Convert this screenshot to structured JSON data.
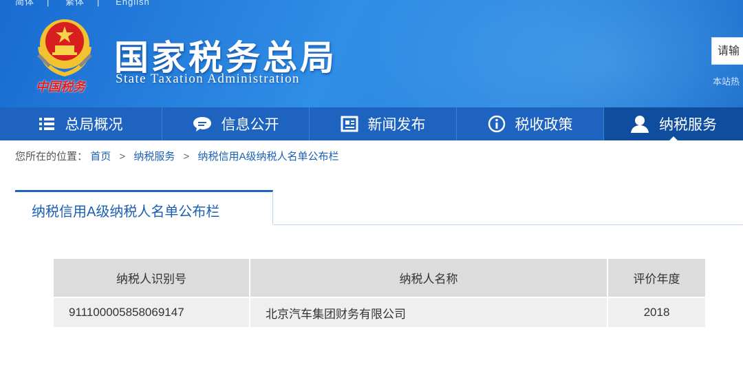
{
  "header": {
    "top_links": [
      "简体",
      "繁体",
      "English"
    ],
    "logo_caption": "中国税务",
    "title": "国家税务总局",
    "subtitle": "State Taxation Administration",
    "search_placeholder": "请输",
    "search_hint": "本站热"
  },
  "nav": {
    "items": [
      {
        "label": "总局概况",
        "icon": "menu-list-icon"
      },
      {
        "label": "信息公开",
        "icon": "chat-bubble-icon"
      },
      {
        "label": "新闻发布",
        "icon": "document-icon"
      },
      {
        "label": "税收政策",
        "icon": "info-circle-icon"
      },
      {
        "label": "纳税服务",
        "icon": "user-icon",
        "active": true
      }
    ]
  },
  "breadcrumb": {
    "prefix": "您所在的位置：",
    "items": [
      "首页",
      "纳税服务",
      "纳税信用A级纳税人名单公布栏"
    ]
  },
  "panel": {
    "tab_title": "纳税信用A级纳税人名单公布栏"
  },
  "table": {
    "headers": [
      "纳税人识别号",
      "纳税人名称",
      "评价年度"
    ],
    "rows": [
      [
        "911100005858069147",
        "北京汽车集团财务有限公司",
        "2018"
      ]
    ]
  },
  "colors": {
    "header_blue": "#2f8ee6",
    "nav_blue": "#1d63bf",
    "nav_active": "#0f4d9e",
    "link_blue": "#1a5fb4"
  }
}
